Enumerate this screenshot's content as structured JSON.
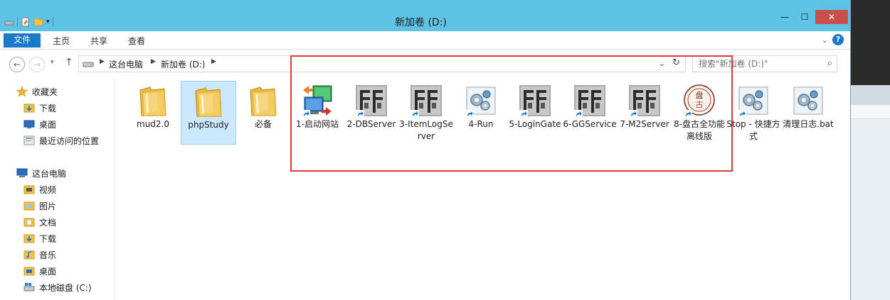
{
  "window": {
    "title": "新加卷 (D:)",
    "controls": {
      "minimize": "—",
      "maximize": "☐",
      "close": "✕"
    }
  },
  "ribbon": {
    "tabs": [
      "文件",
      "主页",
      "共享",
      "查看"
    ]
  },
  "address": {
    "crumbs": [
      "这台电脑",
      "新加卷 (D:)"
    ]
  },
  "search": {
    "placeholder": "搜索\"新加卷 (D:)\""
  },
  "nav": {
    "favorites_header": "收藏夹",
    "favorites": [
      "下载",
      "桌面",
      "最近访问的位置"
    ],
    "pc_header": "这台电脑",
    "pc_items": [
      "视频",
      "图片",
      "文档",
      "下载",
      "音乐",
      "桌面",
      "本地磁盘 (C:)"
    ]
  },
  "files": [
    {
      "label": "mud2.0",
      "kind": "folder"
    },
    {
      "label": "phpStudy",
      "kind": "folder",
      "selected": true
    },
    {
      "label": "必备",
      "kind": "folder"
    },
    {
      "label": "1-启动网站",
      "kind": "network-shortcut"
    },
    {
      "label": "2-DBServer",
      "kind": "dragon-shortcut"
    },
    {
      "label": "3-ItemLogServer",
      "kind": "dragon-shortcut"
    },
    {
      "label": "4-Run",
      "kind": "gear-shortcut"
    },
    {
      "label": "5-LoginGate",
      "kind": "dragon-shortcut"
    },
    {
      "label": "6-GGService",
      "kind": "dragon-shortcut"
    },
    {
      "label": "7-M2Server",
      "kind": "dragon-shortcut"
    },
    {
      "label": "8-盘古全功能离线版",
      "kind": "pangu-shortcut"
    },
    {
      "label": "Stop - 快捷方式",
      "kind": "gear-shortcut"
    },
    {
      "label": "清理日志.bat",
      "kind": "gear"
    }
  ],
  "colors": {
    "titlebar": "#5fc3e6",
    "accent": "#1979ca",
    "highlight": "#e0393e",
    "selection": "#cce8ff"
  }
}
